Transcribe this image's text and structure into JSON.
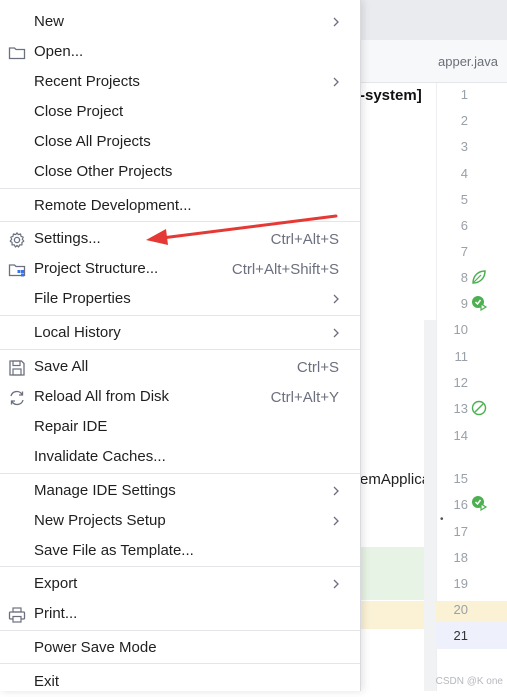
{
  "editor": {
    "tab_title": "apper.java",
    "frag_project": "-system]",
    "frag_class": "emApplica",
    "line_numbers": [
      "1",
      "2",
      "3",
      "4",
      "5",
      "6",
      "7",
      "8",
      "9",
      "10",
      "11",
      "12",
      "13",
      "14",
      "15",
      "16",
      "17",
      "18",
      "19",
      "20",
      "21"
    ],
    "current_line": "21",
    "watermark": "CSDN @K  one"
  },
  "menu": {
    "new": "New",
    "open": "Open...",
    "recent": "Recent Projects",
    "close_project": "Close Project",
    "close_all": "Close All Projects",
    "close_other": "Close Other Projects",
    "remote_dev": "Remote Development...",
    "settings": "Settings...",
    "settings_sc": "Ctrl+Alt+S",
    "project_structure": "Project Structure...",
    "project_structure_sc": "Ctrl+Alt+Shift+S",
    "file_properties": "File Properties",
    "local_history": "Local History",
    "save_all": "Save All",
    "save_all_sc": "Ctrl+S",
    "reload": "Reload All from Disk",
    "reload_sc": "Ctrl+Alt+Y",
    "repair": "Repair IDE",
    "invalidate": "Invalidate Caches...",
    "manage_ide": "Manage IDE Settings",
    "new_projects_setup": "New Projects Setup",
    "save_template": "Save File as Template...",
    "export": "Export",
    "print": "Print...",
    "power_save": "Power Save Mode",
    "exit": "Exit"
  },
  "colors": {
    "annotation_arrow": "#e53935",
    "spring_green": "#4caf50"
  }
}
